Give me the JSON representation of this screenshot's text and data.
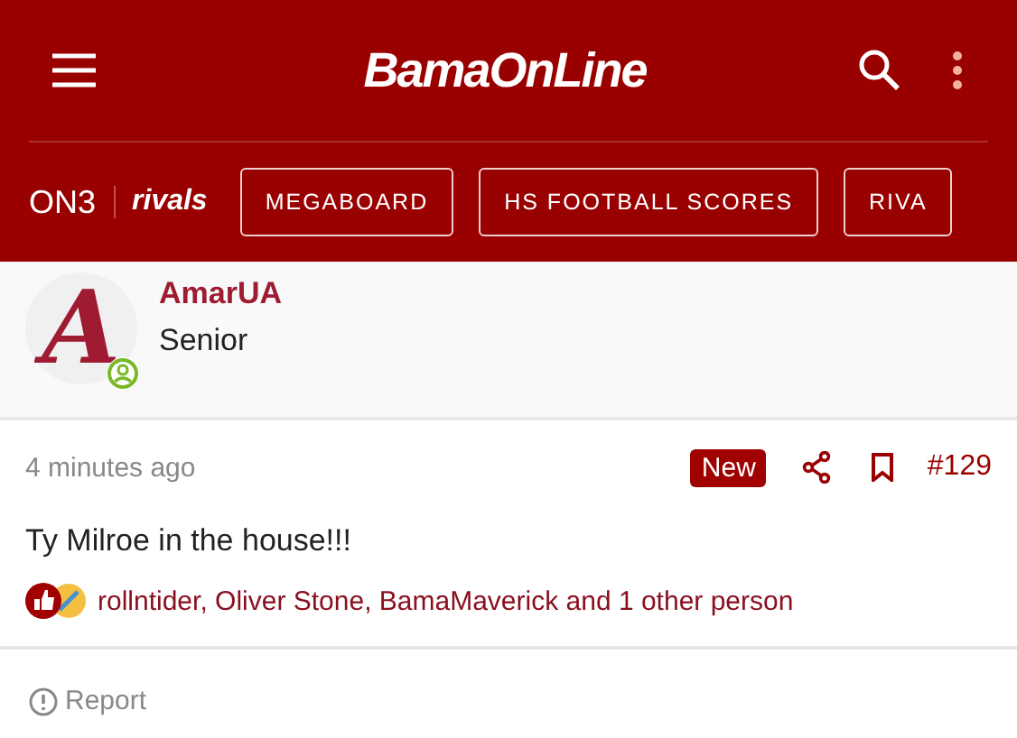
{
  "header": {
    "logo": "BamaOnLine",
    "partners": [
      "ON3",
      "rivals"
    ],
    "nav_buttons": [
      "MEGABOARD",
      "HS FOOTBALL SCORES",
      "RIVA"
    ]
  },
  "author": {
    "avatar_letter": "A",
    "name": "AmarUA",
    "rank": "Senior",
    "online": true
  },
  "post": {
    "time": "4 minutes ago",
    "badge": "New",
    "number": "#129",
    "content": "Ty Milroe in the house!!!",
    "reactions": "rollntider, Oliver Stone, BamaMaverick and 1 other person"
  },
  "footer": {
    "report": "Report"
  }
}
